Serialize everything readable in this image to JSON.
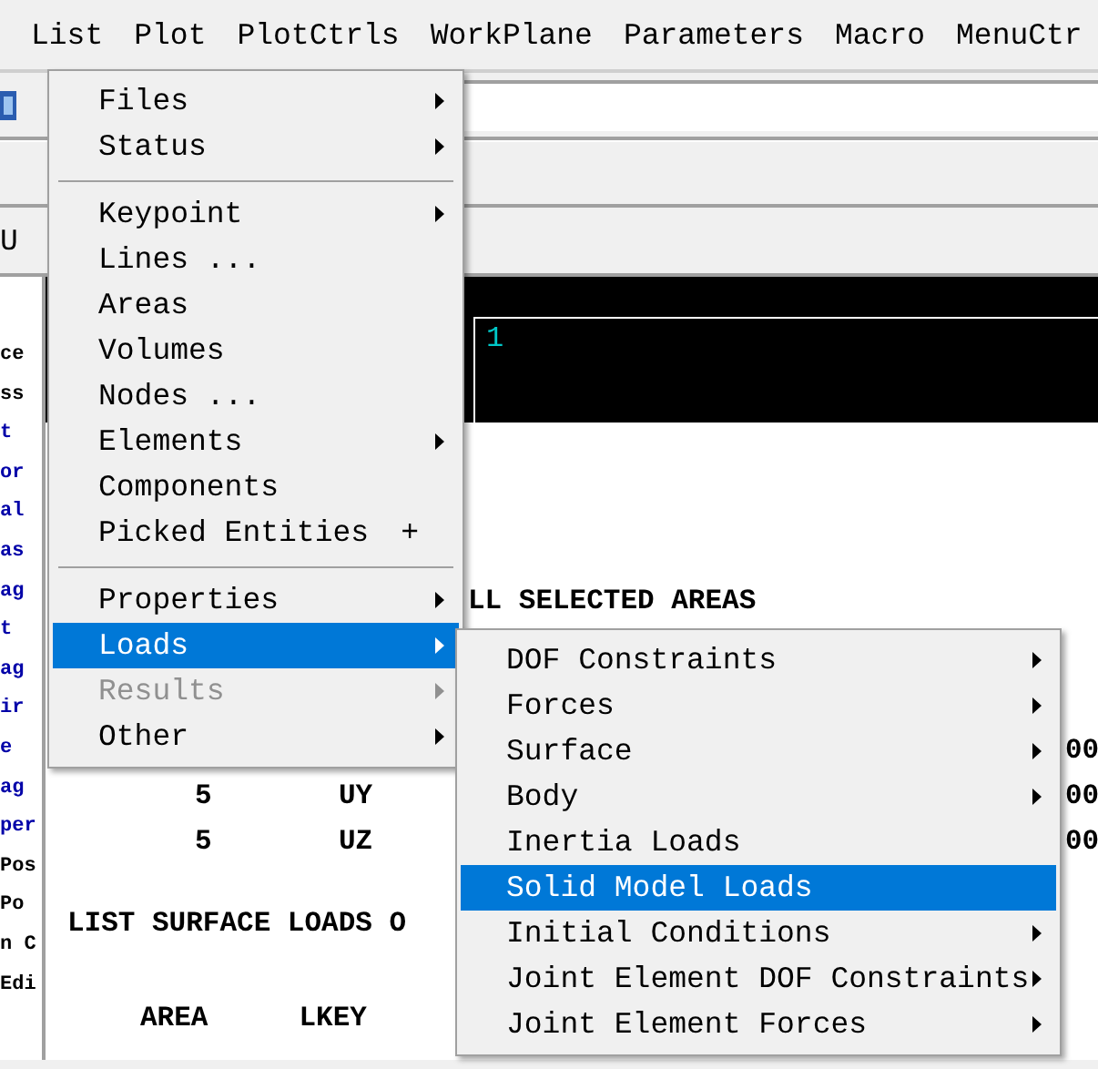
{
  "menu_bar": [
    "List",
    "Plot",
    "PlotCtrls",
    "WorkPlane",
    "Parameters",
    "Macro",
    "MenuCtr"
  ],
  "toolbar": {
    "cut_label": "U"
  },
  "side_panel": [
    {
      "text": "ce",
      "emphasis": false
    },
    {
      "text": "ss",
      "emphasis": false
    },
    {
      "text": "t",
      "emphasis": true
    },
    {
      "text": "or",
      "emphasis": true
    },
    {
      "text": "al",
      "emphasis": true
    },
    {
      "text": "as",
      "emphasis": true
    },
    {
      "text": "ag",
      "emphasis": true
    },
    {
      "text": "t",
      "emphasis": true
    },
    {
      "text": "ag",
      "emphasis": true
    },
    {
      "text": "ir",
      "emphasis": true
    },
    {
      "text": "e",
      "emphasis": true
    },
    {
      "text": "ag",
      "emphasis": true
    },
    {
      "text": "per",
      "emphasis": true
    },
    {
      "text": "Pos",
      "emphasis": false
    },
    {
      "text": "Po",
      "emphasis": false
    },
    {
      "text": "n C",
      "emphasis": false
    },
    {
      "text": "Edi",
      "emphasis": false
    }
  ],
  "graphics": {
    "window_number": "1"
  },
  "output": {
    "header": "LL SELECTED AREAS",
    "rows": [
      {
        "value": "00"
      },
      {
        "area": "5",
        "label": "UY",
        "value": "00"
      },
      {
        "area": "5",
        "label": "UZ",
        "value": "00"
      }
    ],
    "title": "LIST SURFACE LOADS O",
    "columns": [
      "AREA",
      "LKEY"
    ]
  },
  "list_menu": [
    [
      {
        "label": "Files",
        "submenu": true,
        "selected": false,
        "disabled": false
      },
      {
        "label": "Status",
        "submenu": true,
        "selected": false,
        "disabled": false
      }
    ],
    [
      {
        "label": "Keypoint",
        "submenu": true,
        "selected": false,
        "disabled": false
      },
      {
        "label": "Lines ...",
        "submenu": false,
        "selected": false,
        "disabled": false
      },
      {
        "label": "Areas",
        "submenu": false,
        "selected": false,
        "disabled": false
      },
      {
        "label": "Volumes",
        "submenu": false,
        "selected": false,
        "disabled": false
      },
      {
        "label": "Nodes ...",
        "submenu": false,
        "selected": false,
        "disabled": false
      },
      {
        "label": "Elements",
        "submenu": true,
        "selected": false,
        "disabled": false
      },
      {
        "label": "Components",
        "submenu": false,
        "selected": false,
        "disabled": false
      },
      {
        "label": "Picked Entities",
        "shortcut": "+",
        "submenu": false,
        "selected": false,
        "disabled": false
      }
    ],
    [
      {
        "label": "Properties",
        "submenu": true,
        "selected": false,
        "disabled": false
      },
      {
        "label": "Loads",
        "submenu": true,
        "selected": true,
        "disabled": false
      },
      {
        "label": "Results",
        "submenu": true,
        "selected": false,
        "disabled": true
      },
      {
        "label": "Other",
        "submenu": true,
        "selected": false,
        "disabled": false
      }
    ]
  ],
  "loads_menu": [
    {
      "label": "DOF Constraints",
      "submenu": true,
      "selected": false
    },
    {
      "label": "Forces",
      "submenu": true,
      "selected": false
    },
    {
      "label": "Surface",
      "submenu": true,
      "selected": false
    },
    {
      "label": "Body",
      "submenu": true,
      "selected": false
    },
    {
      "label": "Inertia Loads",
      "submenu": false,
      "selected": false
    },
    {
      "label": "Solid Model Loads",
      "submenu": false,
      "selected": true
    },
    {
      "label": "Initial Conditions",
      "submenu": true,
      "selected": false
    },
    {
      "label": "Joint Element DOF Constraints",
      "submenu": true,
      "selected": false
    },
    {
      "label": "Joint Element Forces",
      "submenu": true,
      "selected": false
    }
  ]
}
